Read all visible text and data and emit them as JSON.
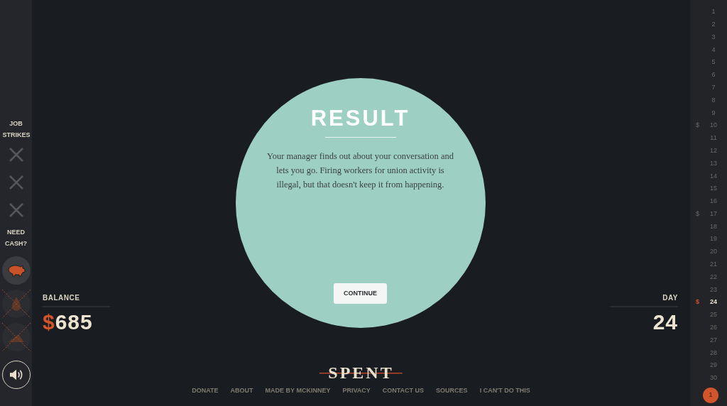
{
  "sidebar": {
    "strikes_label": "JOB STRIKES",
    "strikes": [
      {
        "on": false
      },
      {
        "on": false
      },
      {
        "on": false
      }
    ],
    "cash_label": "NEED CASH?",
    "cash_options": [
      {
        "kind": "piggy",
        "available": true
      },
      {
        "kind": "drop",
        "available": false
      },
      {
        "kind": "wedge",
        "available": false
      }
    ],
    "sound_on": true
  },
  "balance": {
    "label": "BALANCE",
    "currency": "$",
    "amount": "685"
  },
  "day": {
    "label": "DAY",
    "value": "24"
  },
  "result": {
    "title": "RESULT",
    "text": "Your manager finds out about your conversation and lets you go. Firing workers for union activity is illegal, but that doesn't keep it from happening.",
    "button": "CONTINUE"
  },
  "footer": {
    "logo": "SPENT",
    "links": [
      "DONATE",
      "ABOUT",
      "MADE BY MCKINNEY",
      "PRIVACY",
      "CONTACT US",
      "SOURCES",
      "I CAN'T DO THIS"
    ]
  },
  "calendar": {
    "days": [
      {
        "label": "1",
        "selected": false
      },
      {
        "label": "2",
        "selected": false
      },
      {
        "label": "3",
        "selected": false
      },
      {
        "label": "4",
        "selected": false
      },
      {
        "label": "5",
        "selected": false
      },
      {
        "label": "6",
        "selected": false
      },
      {
        "label": "7",
        "selected": false
      },
      {
        "label": "8",
        "selected": false
      },
      {
        "label": "9",
        "selected": false
      },
      {
        "label": "10",
        "marker": "$",
        "selected": false
      },
      {
        "label": "11",
        "selected": false
      },
      {
        "label": "12",
        "selected": false
      },
      {
        "label": "13",
        "selected": false
      },
      {
        "label": "14",
        "selected": false
      },
      {
        "label": "15",
        "selected": false
      },
      {
        "label": "16",
        "selected": false
      },
      {
        "label": "17",
        "marker": "$",
        "selected": false
      },
      {
        "label": "18",
        "selected": false
      },
      {
        "label": "19",
        "selected": false
      },
      {
        "label": "20",
        "selected": false
      },
      {
        "label": "21",
        "selected": false
      },
      {
        "label": "22",
        "selected": false
      },
      {
        "label": "23",
        "selected": false
      },
      {
        "label": "24",
        "marker": "$",
        "selected": true
      },
      {
        "label": "25",
        "selected": false
      },
      {
        "label": "26",
        "selected": false
      },
      {
        "label": "27",
        "selected": false
      },
      {
        "label": "28",
        "selected": false
      },
      {
        "label": "29",
        "selected": false
      },
      {
        "label": "30",
        "selected": false
      }
    ],
    "next_month": "1"
  }
}
